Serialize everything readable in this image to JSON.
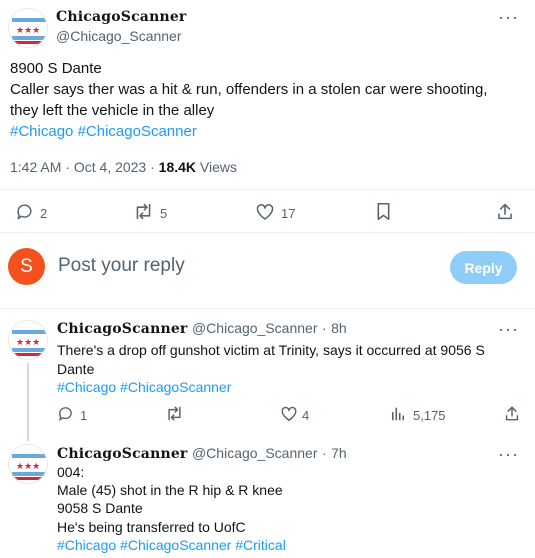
{
  "main_tweet": {
    "display_name": "ChicagoScanner",
    "handle": "@Chicago_Scanner",
    "lines": [
      "8900 S Dante",
      "Caller says ther was a hit & run, offenders in a stolen car were shooting,",
      "they left the vehicle in the alley"
    ],
    "hashtags": [
      "#Chicago",
      "#ChicagoScanner"
    ],
    "time": "1:42 AM",
    "date": "Oct 4, 2023",
    "separator": "·",
    "views_count": "18.4K",
    "views_label": "Views",
    "actions": {
      "replies": "2",
      "retweets": "5",
      "likes": "17"
    }
  },
  "reply_composer": {
    "avatar_letter": "S",
    "avatar_color": "#f4511e",
    "placeholder": "Post your reply",
    "button_label": "Reply"
  },
  "replies": [
    {
      "display_name": "ChicagoScanner",
      "handle": "@Chicago_Scanner",
      "time": "8h",
      "lines": [
        "There's a drop off gunshot victim at Trinity, says it occurred at 9056 S",
        "Dante"
      ],
      "hashtags": [
        "#Chicago",
        "#ChicagoScanner"
      ],
      "actions": {
        "replies": "1",
        "retweets": "",
        "likes": "4",
        "views": "5,175"
      }
    },
    {
      "display_name": "ChicagoScanner",
      "handle": "@Chicago_Scanner",
      "time": "7h",
      "lines": [
        "004:",
        "Male (45) shot in the R hip & R knee",
        "9058 S Dante",
        "He's being transferred to UofC"
      ],
      "hashtags": [
        "#Chicago",
        "#ChicagoScanner",
        "#Critical"
      ]
    }
  ],
  "colors": {
    "accent": "#1d9bf0",
    "reply_button_disabled": "#8ecdf8",
    "muted": "#536471"
  }
}
